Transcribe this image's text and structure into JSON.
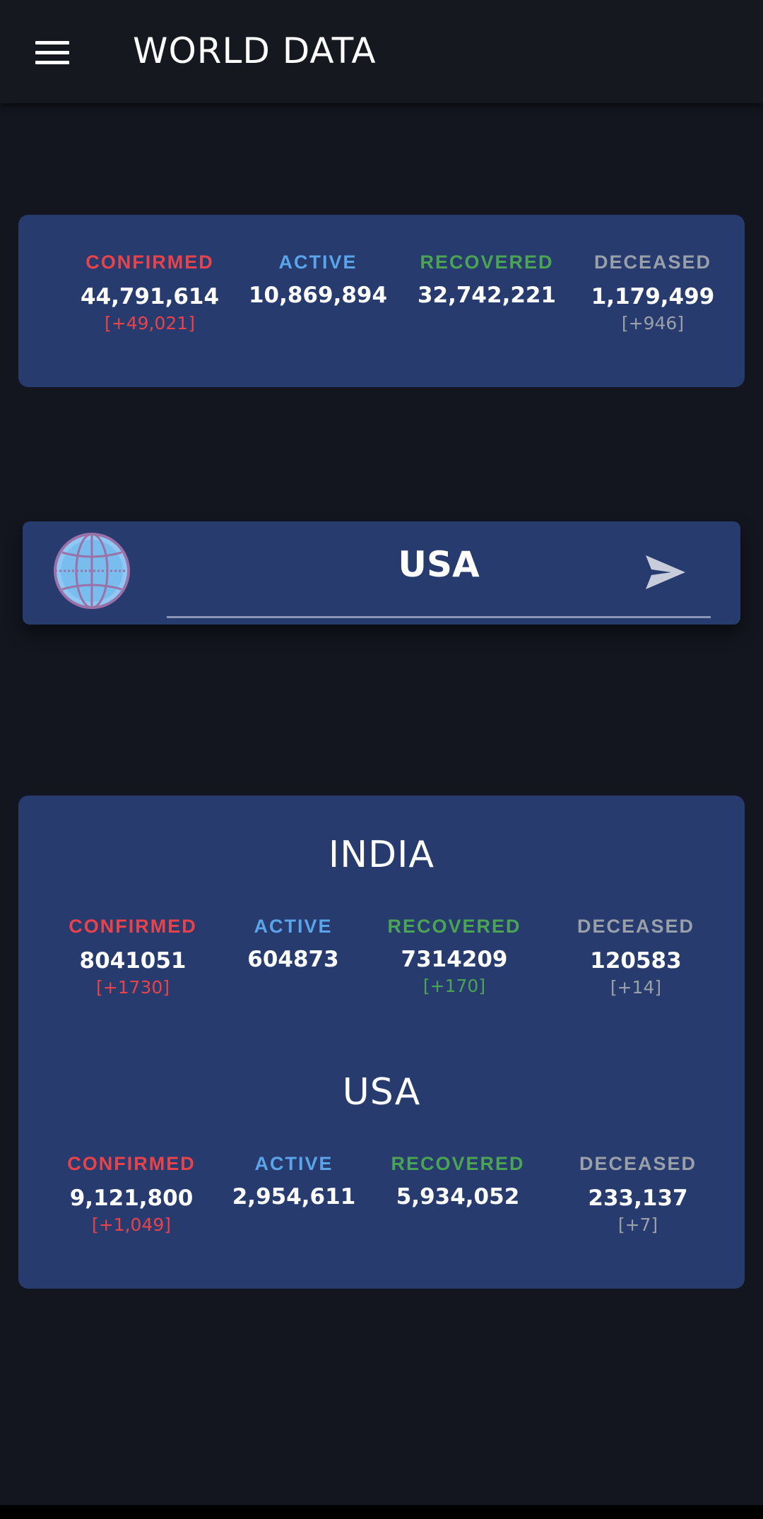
{
  "app_bar": {
    "title": "WORLD DATA"
  },
  "world": {
    "confirmed": {
      "label": "CONFIRMED",
      "value": "44,791,614",
      "delta": "[+49,021]"
    },
    "active": {
      "label": "ACTIVE",
      "value": "10,869,894"
    },
    "recovered": {
      "label": "RECOVERED",
      "value": "32,742,221"
    },
    "deceased": {
      "label": "DECEASED",
      "value": "1,179,499",
      "delta": "[+946]"
    }
  },
  "search": {
    "value": "USA",
    "icon": "globe-icon",
    "send_icon": "send-icon"
  },
  "countries": [
    {
      "name": "INDIA",
      "confirmed": {
        "label": "CONFIRMED",
        "value": "8041051",
        "delta": "[+1730]"
      },
      "active": {
        "label": "ACTIVE",
        "value": "604873"
      },
      "recovered": {
        "label": "RECOVERED",
        "value": "7314209",
        "delta": "[+170]"
      },
      "deceased": {
        "label": "DECEASED",
        "value": "120583",
        "delta": "[+14]"
      }
    },
    {
      "name": "USA",
      "confirmed": {
        "label": "CONFIRMED",
        "value": "9,121,800",
        "delta": "[+1,049]"
      },
      "active": {
        "label": "ACTIVE",
        "value": "2,954,611"
      },
      "recovered": {
        "label": "RECOVERED",
        "value": "5,934,052"
      },
      "deceased": {
        "label": "DECEASED",
        "value": "233,137",
        "delta": "[+7]"
      }
    }
  ],
  "colors": {
    "background": "#13161f",
    "card": "#273b6f",
    "confirmed": "#e8434a",
    "active": "#5aa4ea",
    "recovered": "#4aa454",
    "deceased": "#9aa0a8"
  }
}
